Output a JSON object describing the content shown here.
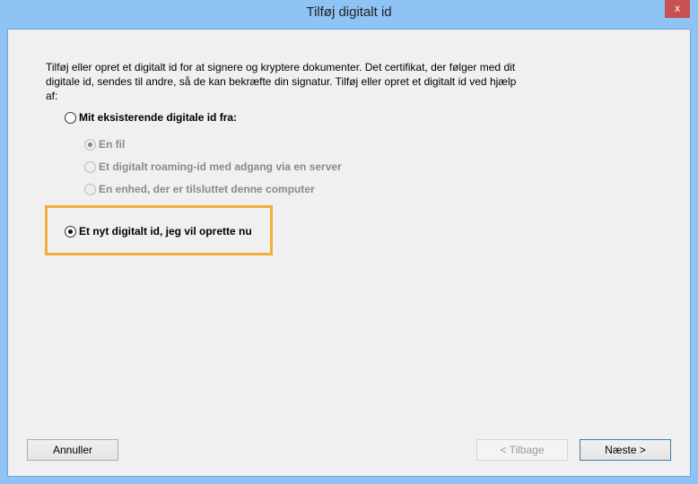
{
  "window": {
    "title": "Tilføj digitalt id",
    "close_label": "x"
  },
  "intro": "Tilføj eller opret et digitalt id for at signere og kryptere dokumenter. Det certifikat, der følger med dit digitale id, sendes til andre, så de kan bekræfte din signatur. Tilføj eller opret et digitalt id ved hjælp af:",
  "options": {
    "existing": {
      "label": "Mit eksisterende digitale id fra:",
      "selected": false
    },
    "sub": [
      {
        "label": "En fil",
        "selected": true,
        "disabled": true
      },
      {
        "label": "Et digitalt roaming-id med adgang via en server",
        "selected": false,
        "disabled": true
      },
      {
        "label": "En enhed, der er tilsluttet denne computer",
        "selected": false,
        "disabled": true
      }
    ],
    "new": {
      "label": "Et nyt digitalt id, jeg vil oprette nu",
      "selected": true
    }
  },
  "buttons": {
    "cancel": "Annuller",
    "back": "< Tilbage",
    "next": "Næste >"
  },
  "colors": {
    "highlight": "#f6ae3a",
    "titlebar": "#8fc3f4"
  }
}
